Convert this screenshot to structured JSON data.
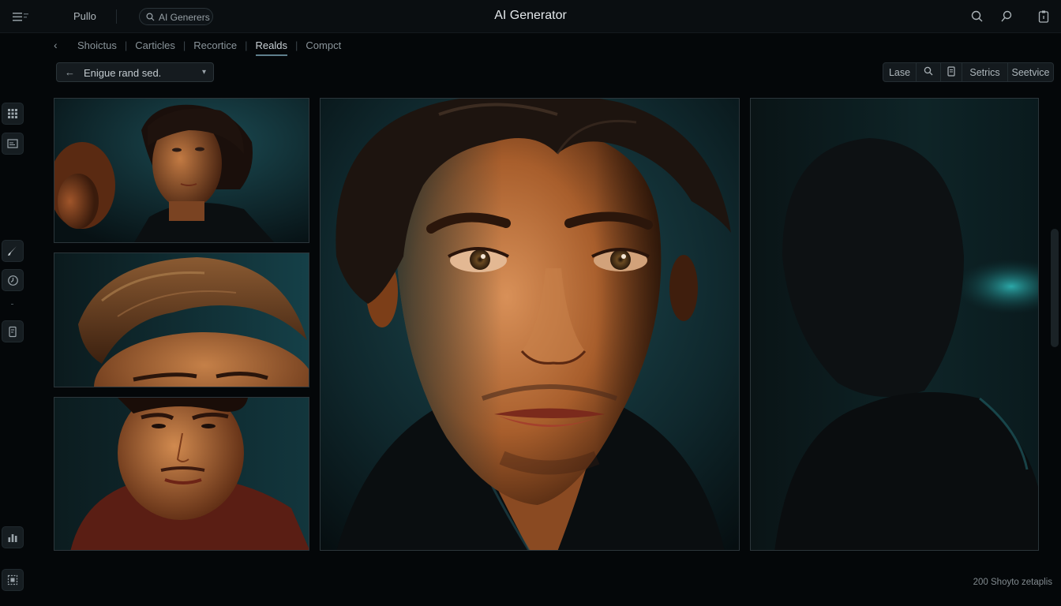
{
  "topbar": {
    "brand": "Pullo",
    "search_label": "AI Generers",
    "app_title": "AI Generator",
    "menu_icon": "menu-icon",
    "right_icons": [
      "search-icon",
      "pin-search-icon",
      "clipboard-icon"
    ]
  },
  "nav": {
    "back_icon": "chevron-left-icon",
    "tabs": [
      {
        "label": "Shoictus",
        "active": false
      },
      {
        "label": "Carticles",
        "active": false
      },
      {
        "label": "Recortice",
        "active": false
      },
      {
        "label": "Realds",
        "active": true
      },
      {
        "label": "Compct",
        "active": false
      }
    ]
  },
  "selector": {
    "value": "Enigue rand sed.",
    "icon": "arrow-left-icon",
    "dropdown_icon": "chevron-down-icon"
  },
  "toolbar": {
    "last_label": "Lase",
    "search_icon": "search-icon",
    "doc_icon": "document-icon",
    "settings_label": "Setrics",
    "service_label": "Seetvice"
  },
  "sidebar": {
    "icons": [
      "grid-icon",
      "layout-icon",
      "brush-icon",
      "clock-icon",
      "document-icon",
      "stats-icon",
      "frame-icon"
    ]
  },
  "gallery": {
    "images": [
      {
        "name": "thumbnail-man-profile"
      },
      {
        "name": "thumbnail-hair-closeup"
      },
      {
        "name": "thumbnail-stern-face"
      },
      {
        "name": "main-portrait"
      },
      {
        "name": "shadow-silhouette"
      }
    ]
  },
  "colors": {
    "background": "#040709",
    "accent_teal": "#1f6f78",
    "skin_warm": "#b0662c"
  },
  "footer": {
    "status": "200 Shoyto zetaplis"
  }
}
